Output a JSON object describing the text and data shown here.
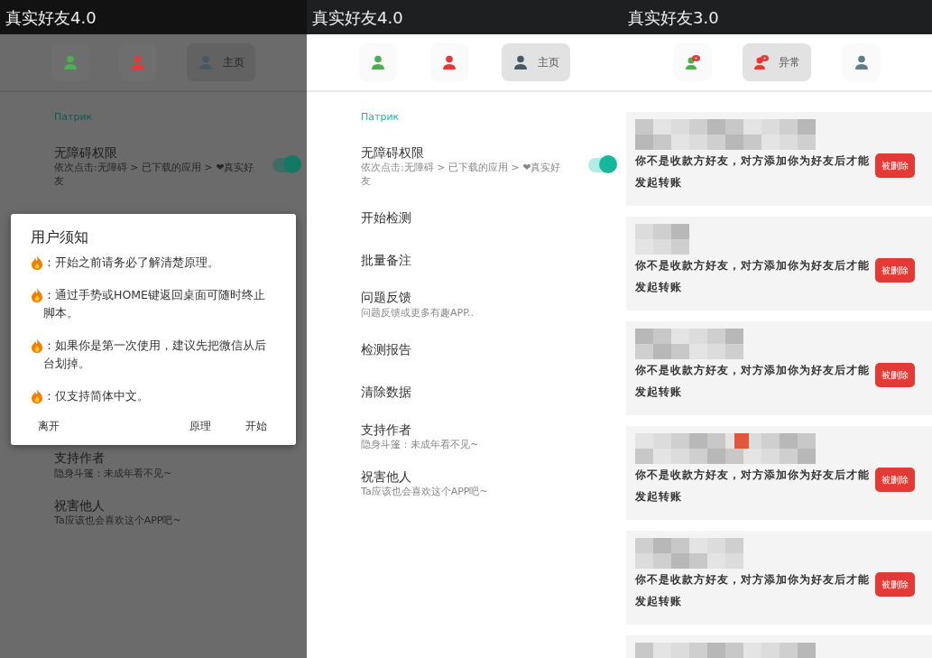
{
  "panels": [
    {
      "title": "真实好友4.0",
      "tabs": [
        {
          "kind": "person",
          "color": "#4caf50",
          "selected": false
        },
        {
          "kind": "person",
          "color": "#e53935",
          "selected": false
        },
        {
          "kind": "person",
          "color": "#455a64",
          "selected": true,
          "label": "主页"
        }
      ],
      "section": "Патрик",
      "items": [
        {
          "title": "无障碍权限",
          "subtitle": "依次点击:无障碍 > 已下载的应用 > ❤真实好友",
          "toggle": {
            "on": true
          }
        },
        {
          "title": "支持作者",
          "subtitle": "隐身斗篷：未成年看不见~"
        },
        {
          "title": "祝害他人",
          "subtitle": "Ta应该也会喜欢这个APP吧~"
        }
      ],
      "dimmed": true,
      "dialog": {
        "title": "用户须知",
        "lines": [
          "：开始之前请务必了解清楚原理。",
          "：通过手势或HOME键返回桌面可随时终止脚本。",
          "：如果你是第一次使用，建议先把微信从后台划掉。",
          "：仅支持简体中文。"
        ],
        "left_button": "离开",
        "buttons": [
          "原理",
          "开始"
        ]
      }
    },
    {
      "title": "真实好友4.0",
      "tabs": [
        {
          "kind": "person",
          "color": "#4caf50",
          "selected": false
        },
        {
          "kind": "person",
          "color": "#e53935",
          "selected": false
        },
        {
          "kind": "person",
          "color": "#455a64",
          "selected": true,
          "label": "主页"
        }
      ],
      "section": "Патрик",
      "items": [
        {
          "title": "无障碍权限",
          "subtitle": "依次点击:无障碍 > 已下载的应用 > ❤真实好友",
          "toggle": {
            "on": true
          }
        },
        {
          "title": "开始检测"
        },
        {
          "title": "批量备注"
        },
        {
          "title": "问题反馈",
          "subtitle": "问题反馈或更多有趣APP.."
        },
        {
          "title": "检测报告"
        },
        {
          "title": "清除数据"
        },
        {
          "title": "支持作者",
          "subtitle": "隐身斗篷：未成年看不见~"
        },
        {
          "title": "祝害他人",
          "subtitle": "Ta应该也会喜欢这个APP吧~"
        }
      ],
      "dimmed": false
    },
    {
      "title": "真实好友3.0",
      "tabs": [
        {
          "kind": "bubble",
          "color": "#4caf50",
          "selected": false
        },
        {
          "kind": "bubble",
          "color": "#e53935",
          "selected": true,
          "label": "异常"
        },
        {
          "kind": "person",
          "color": "#607d8b",
          "selected": false
        }
      ],
      "records": [
        {
          "kind": "full",
          "message": "你不是收款方好友，对方添加你为好友后才能发起转账",
          "status": "被删除"
        },
        {
          "kind": "full",
          "message": "你不是收款方好友，对方添加你为好友后才能发起转账",
          "status": "被删除"
        },
        {
          "kind": "full",
          "message": "你不是收款方好友，对方添加你为好友后才能发起转账",
          "status": "被删除"
        },
        {
          "kind": "full",
          "message": "你不是收款方好友，对方添加你为好友后才能发起转账",
          "status": "被删除"
        },
        {
          "kind": "full",
          "message": "你不是收款方好友，对方添加你为好友后才能发起转账",
          "status": "被删除"
        },
        {
          "kind": "cut"
        }
      ],
      "dimmed": false
    }
  ]
}
